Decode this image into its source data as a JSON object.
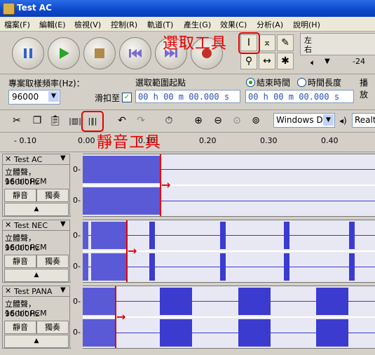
{
  "window": {
    "title": "Test AC"
  },
  "menu": [
    "檔案(F)",
    "編輯(E)",
    "檢視(V)",
    "控制(R)",
    "軌道(T)",
    "產生(G)",
    "效果(C)",
    "分析(A)",
    "說明(H)"
  ],
  "annotations": {
    "select_tool": "選取工具",
    "silence_tool": "靜音工具"
  },
  "meter": {
    "left": "左",
    "right": "右",
    "db": "-24"
  },
  "settings": {
    "rate_label": "專案取樣頻率(Hz)：",
    "rate_value": "96000",
    "snap_label": "滑扣至",
    "selection_start_label": "選取範圍起點",
    "end_time_label": "結束時間",
    "duration_label": "時間長度",
    "play_label": "播放",
    "time_start": "00 h 00 m 00.000 s",
    "time_end": "00 h 00 m 00.000 s"
  },
  "devices": {
    "output": "Windows Di",
    "input": "Realte"
  },
  "ruler": {
    "labels": [
      "- 0.10",
      "0.00",
      "0.10",
      "0.20",
      "0.30",
      "0.40"
    ]
  },
  "tracks": [
    {
      "name": "Test AC",
      "info1": "立體聲，96000Hz",
      "info2": "16-bit PCM",
      "mute": "靜音",
      "solo": "獨奏",
      "scale": "0-"
    },
    {
      "name": "Test NEC",
      "info1": "立體聲，96000Hz",
      "info2": "16-bit PCM",
      "mute": "靜音",
      "solo": "獨奏",
      "scale": "0-"
    },
    {
      "name": "Test PANA",
      "info1": "立體聲，96000Hz",
      "info2": "16-bit PCM",
      "mute": "靜音",
      "solo": "獨奏",
      "scale": "0-"
    }
  ],
  "colors": {
    "waveform": "#3b3bd0",
    "annotation": "#e60000",
    "title_bar": "#0b47c9"
  }
}
